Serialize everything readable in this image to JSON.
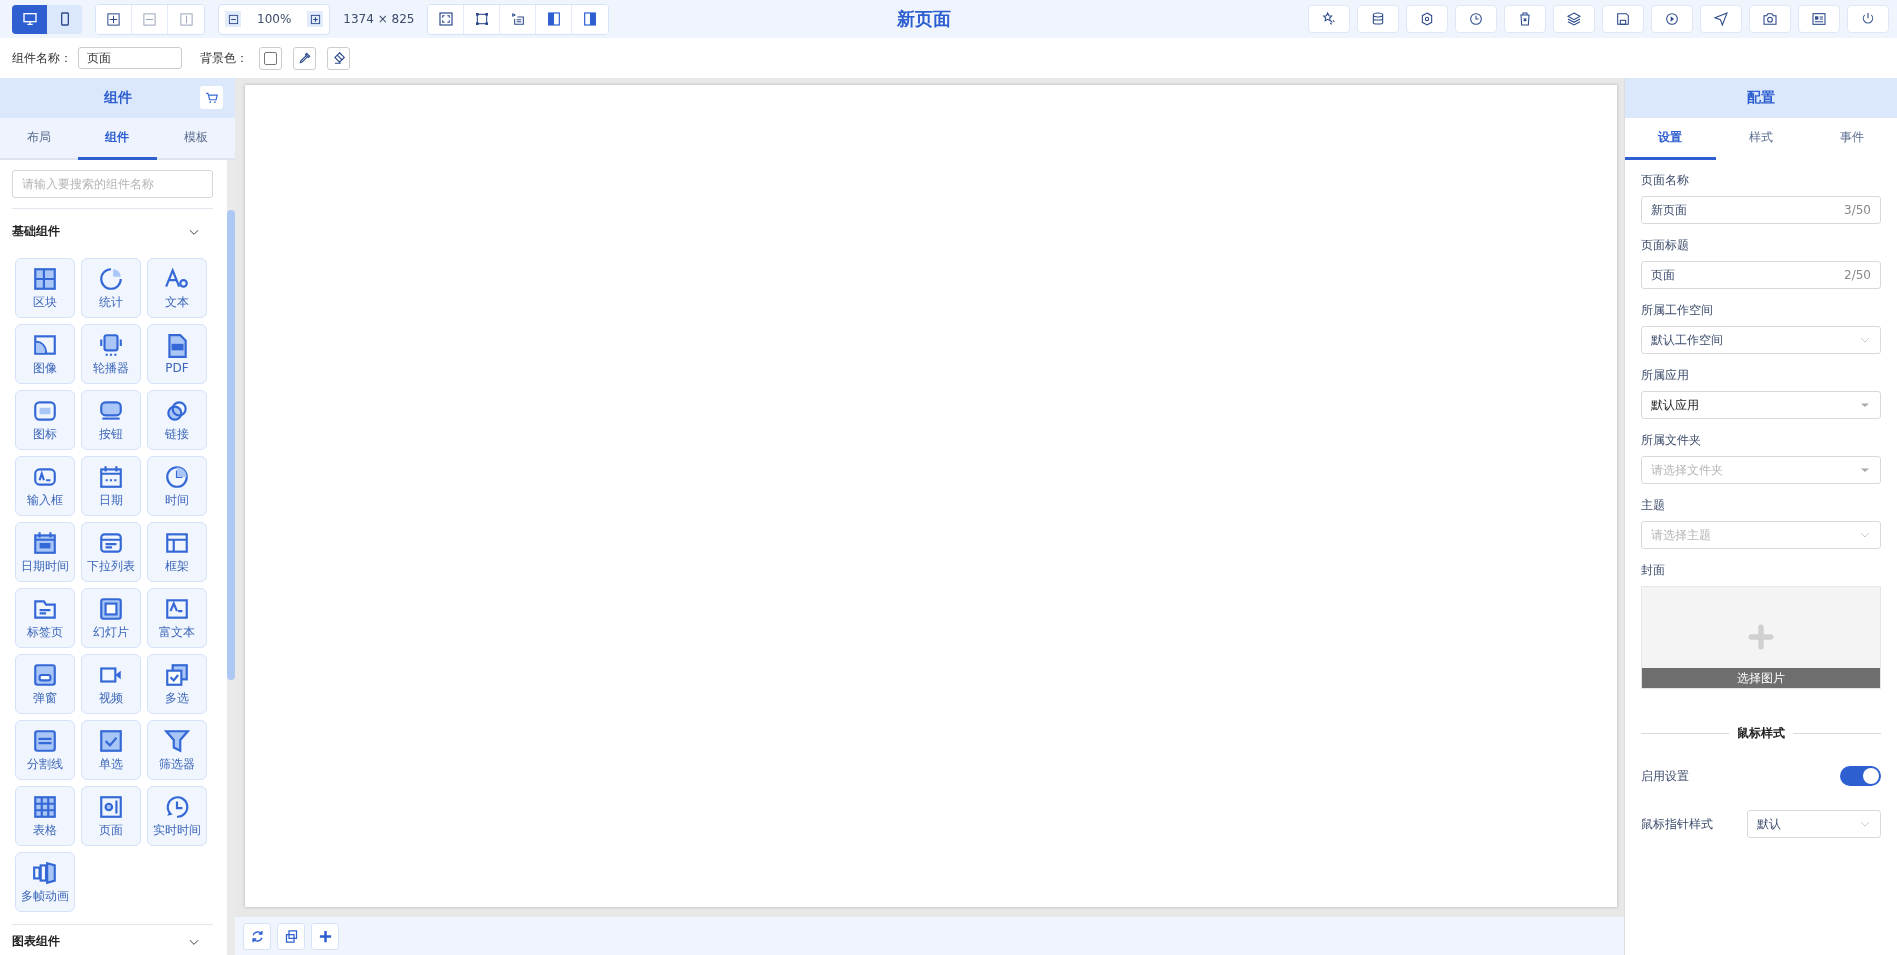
{
  "top_bar": {
    "devices": [
      {
        "selected": true
      },
      {
        "selected": false
      }
    ],
    "edit_tools": [
      {
        "disabled": false
      },
      {
        "disabled": true
      },
      {
        "disabled": true
      }
    ],
    "zoom": "100%",
    "canvas_size": "1374 × 825",
    "title": "新页面"
  },
  "props_bar": {
    "name_label": "组件名称：",
    "name_value": "页面",
    "bg_label": "背景色："
  },
  "left_panel": {
    "title": "组件",
    "tabs": [
      {
        "label": "布局",
        "selected": false
      },
      {
        "label": "组件",
        "selected": true
      },
      {
        "label": "模板",
        "selected": false
      }
    ],
    "search": {
      "placeholder": "请输入要搜索的组件名称"
    },
    "sections": [
      {
        "title": "基础组件",
        "items": [
          "区块",
          "统计",
          "文本",
          "图像",
          "轮播器",
          "PDF",
          "图标",
          "按钮",
          "链接",
          "输入框",
          "日期",
          "时间",
          "日期时间",
          "下拉列表",
          "框架",
          "标签页",
          "幻灯片",
          "富文本",
          "弹窗",
          "视频",
          "多选",
          "分割线",
          "单选",
          "筛选器",
          "表格",
          "页面",
          "实时时间",
          "多帧动画"
        ]
      },
      {
        "title": "图表组件"
      }
    ]
  },
  "right_panel": {
    "title": "配置",
    "tabs": [
      {
        "label": "设置",
        "selected": true
      },
      {
        "label": "样式",
        "selected": false
      },
      {
        "label": "事件",
        "selected": false
      }
    ],
    "fields": [
      {
        "kind": "input",
        "label": "页面名称",
        "value": "新页面",
        "counter": "3/50"
      },
      {
        "kind": "input",
        "label": "页面标题",
        "value": "页面",
        "counter": "2/50"
      },
      {
        "kind": "select",
        "label": "所属工作空间",
        "value": "默认工作空间"
      },
      {
        "kind": "combo",
        "label": "所属应用",
        "value": "默认应用"
      },
      {
        "kind": "combo",
        "label": "所属文件夹",
        "placeholder": "请选择文件夹"
      },
      {
        "kind": "select",
        "label": "主题",
        "placeholder": "请选择主题"
      }
    ],
    "cover": {
      "label": "封面",
      "button": "选择图片"
    },
    "section_title": "鼠标样式",
    "switch": {
      "label": "启用设置",
      "on": true
    },
    "cursor": {
      "label": "鼠标指针样式",
      "value": "默认"
    }
  }
}
